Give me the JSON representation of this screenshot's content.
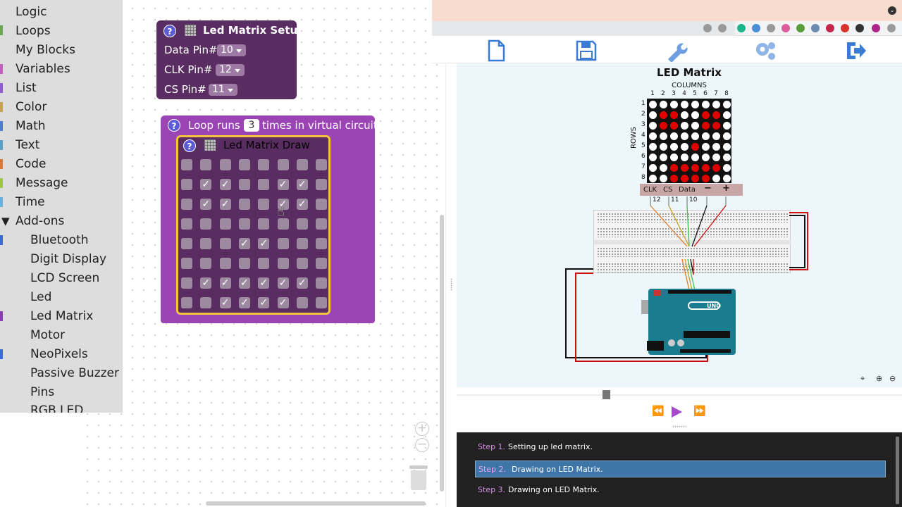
{
  "toolbox": {
    "items": [
      "Logic",
      "Loops",
      "My Blocks",
      "Variables",
      "List",
      "Color",
      "Math",
      "Text",
      "Code",
      "Message",
      "Time"
    ],
    "addons_label": "Add-ons",
    "addons_arrow": "▼",
    "addon_items": [
      "Bluetooth",
      "Digit Display",
      "LCD Screen",
      "Led",
      "Led Matrix",
      "Motor",
      "NeoPixels",
      "Passive Buzzer",
      "Pins",
      "RGB LED"
    ]
  },
  "setup_block": {
    "title": "Led Matrix Setup",
    "help": "?",
    "fields": [
      {
        "label": "Data Pin#",
        "value": "10"
      },
      {
        "label": "CLK Pin#",
        "value": "12"
      },
      {
        "label": "CS Pin#",
        "value": "11"
      }
    ]
  },
  "loop_block": {
    "prefix": "Loop runs",
    "count": "3",
    "suffix": "times in virtual circuit",
    "help": "?"
  },
  "draw_block": {
    "title": "Led Matrix Draw",
    "help": "?",
    "check_glyph": "✓",
    "grid": [
      [
        0,
        0,
        0,
        0,
        0,
        0,
        0,
        0
      ],
      [
        0,
        1,
        1,
        0,
        0,
        1,
        1,
        0
      ],
      [
        0,
        1,
        1,
        0,
        0,
        1,
        1,
        0
      ],
      [
        0,
        0,
        0,
        0,
        0,
        0,
        0,
        0
      ],
      [
        0,
        0,
        0,
        1,
        1,
        0,
        0,
        0
      ],
      [
        0,
        0,
        0,
        0,
        0,
        0,
        0,
        0
      ],
      [
        0,
        1,
        1,
        1,
        1,
        1,
        1,
        0
      ],
      [
        0,
        0,
        1,
        1,
        1,
        1,
        0,
        0
      ]
    ]
  },
  "workspace_controls": {
    "zoom_in": "+",
    "zoom_out": "−"
  },
  "simulator": {
    "title": "LED Matrix",
    "columns_label": "COLUMNS",
    "rows_label": "ROWS",
    "col_numbers": [
      "1",
      "2",
      "3",
      "4",
      "5",
      "6",
      "7",
      "8"
    ],
    "row_numbers": [
      "1",
      "2",
      "3",
      "4",
      "5",
      "6",
      "7",
      "8"
    ],
    "led_state": [
      [
        0,
        0,
        0,
        0,
        0,
        0,
        0,
        0
      ],
      [
        0,
        1,
        1,
        0,
        0,
        1,
        1,
        0
      ],
      [
        0,
        1,
        1,
        0,
        0,
        1,
        1,
        0
      ],
      [
        0,
        0,
        0,
        0,
        0,
        0,
        0,
        0
      ],
      [
        0,
        0,
        0,
        0,
        1,
        0,
        0,
        0
      ],
      [
        0,
        0,
        0,
        0,
        0,
        0,
        0,
        0
      ],
      [
        0,
        0,
        1,
        1,
        1,
        1,
        1,
        0
      ],
      [
        0,
        0,
        1,
        1,
        1,
        1,
        0,
        0
      ]
    ],
    "led_on_color": "#e00000",
    "pin_labels": [
      "CLK",
      "CS",
      "Data",
      "−",
      "+"
    ],
    "pin_numbers": [
      "12",
      "11",
      "10"
    ],
    "board_label": "UNO"
  },
  "playback": {
    "rewind": "⏪",
    "forward": "⏩"
  },
  "steps": [
    {
      "num": "Step 1.",
      "text": "Setting up led matrix."
    },
    {
      "num": "Step 2.",
      "text": "Drawing on LED Matrix."
    },
    {
      "num": "Step 3.",
      "text": "Drawing on LED Matrix."
    }
  ],
  "colors": {
    "setup_block": "#5a2d62",
    "loop_block": "#9b45b5",
    "active_step": "#3f76a8",
    "play_button": "#a64ac9"
  }
}
